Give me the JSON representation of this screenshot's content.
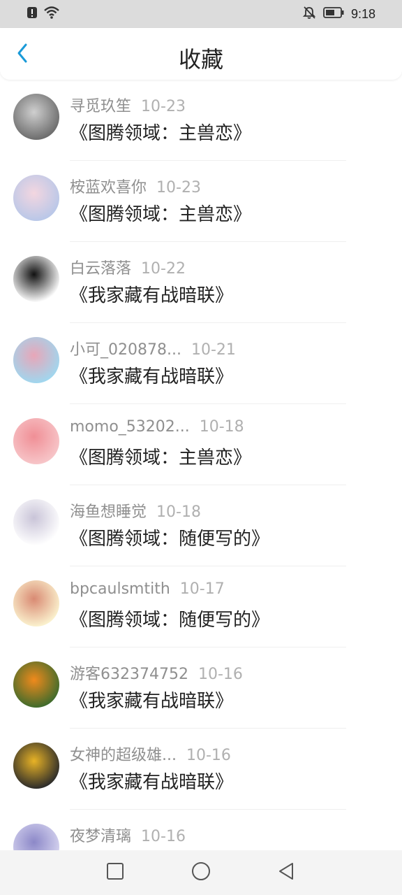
{
  "status_bar": {
    "time": "9:18",
    "icons": [
      "alert-icon",
      "wifi-icon",
      "mute-icon",
      "battery-icon"
    ]
  },
  "header": {
    "title": "收藏",
    "back_icon": "chevron-left-icon"
  },
  "items": [
    {
      "user": "寻觅玖笙",
      "date": "10-23",
      "title": "《图腾领域：主兽恋》",
      "avatar_colors": [
        "#6b6b6b",
        "#cfcfcf"
      ]
    },
    {
      "user": "桉蓝欢喜你",
      "date": "10-23",
      "title": "《图腾领域：主兽恋》",
      "avatar_colors": [
        "#b8c7e8",
        "#f3d6e0"
      ]
    },
    {
      "user": "白云落落",
      "date": "10-22",
      "title": "《我家藏有战暗联》",
      "avatar_colors": [
        "#ffffff",
        "#111111"
      ]
    },
    {
      "user": "小可_020878...",
      "date": "10-21",
      "title": "《我家藏有战暗联》",
      "avatar_colors": [
        "#9fd7ef",
        "#e8a6b8"
      ]
    },
    {
      "user": "momo_53202...",
      "date": "10-18",
      "title": "《图腾领域：主兽恋》",
      "avatar_colors": [
        "#f7c6c9",
        "#f08f96"
      ]
    },
    {
      "user": "海鱼想睡觉",
      "date": "10-18",
      "title": "《图腾领域：随便写的》",
      "avatar_colors": [
        "#ffffff",
        "#c9c4d8"
      ]
    },
    {
      "user": "bpcaulsmtith",
      "date": "10-17",
      "title": "《图腾领域：随便写的》",
      "avatar_colors": [
        "#fbf3cf",
        "#d98a73"
      ]
    },
    {
      "user": "游客632374752",
      "date": "10-16",
      "title": "《我家藏有战暗联》",
      "avatar_colors": [
        "#3d6b2c",
        "#f08a1c"
      ]
    },
    {
      "user": "女神的超级雄...",
      "date": "10-16",
      "title": "《我家藏有战暗联》",
      "avatar_colors": [
        "#2a2a2a",
        "#e8b326"
      ]
    },
    {
      "user": "夜梦清璃",
      "date": "10-16",
      "title": "",
      "avatar_colors": [
        "#d7d5f0",
        "#8c88c8"
      ]
    }
  ],
  "nav_bar": {
    "icons": [
      "recent-apps-icon",
      "home-icon",
      "back-icon"
    ]
  }
}
